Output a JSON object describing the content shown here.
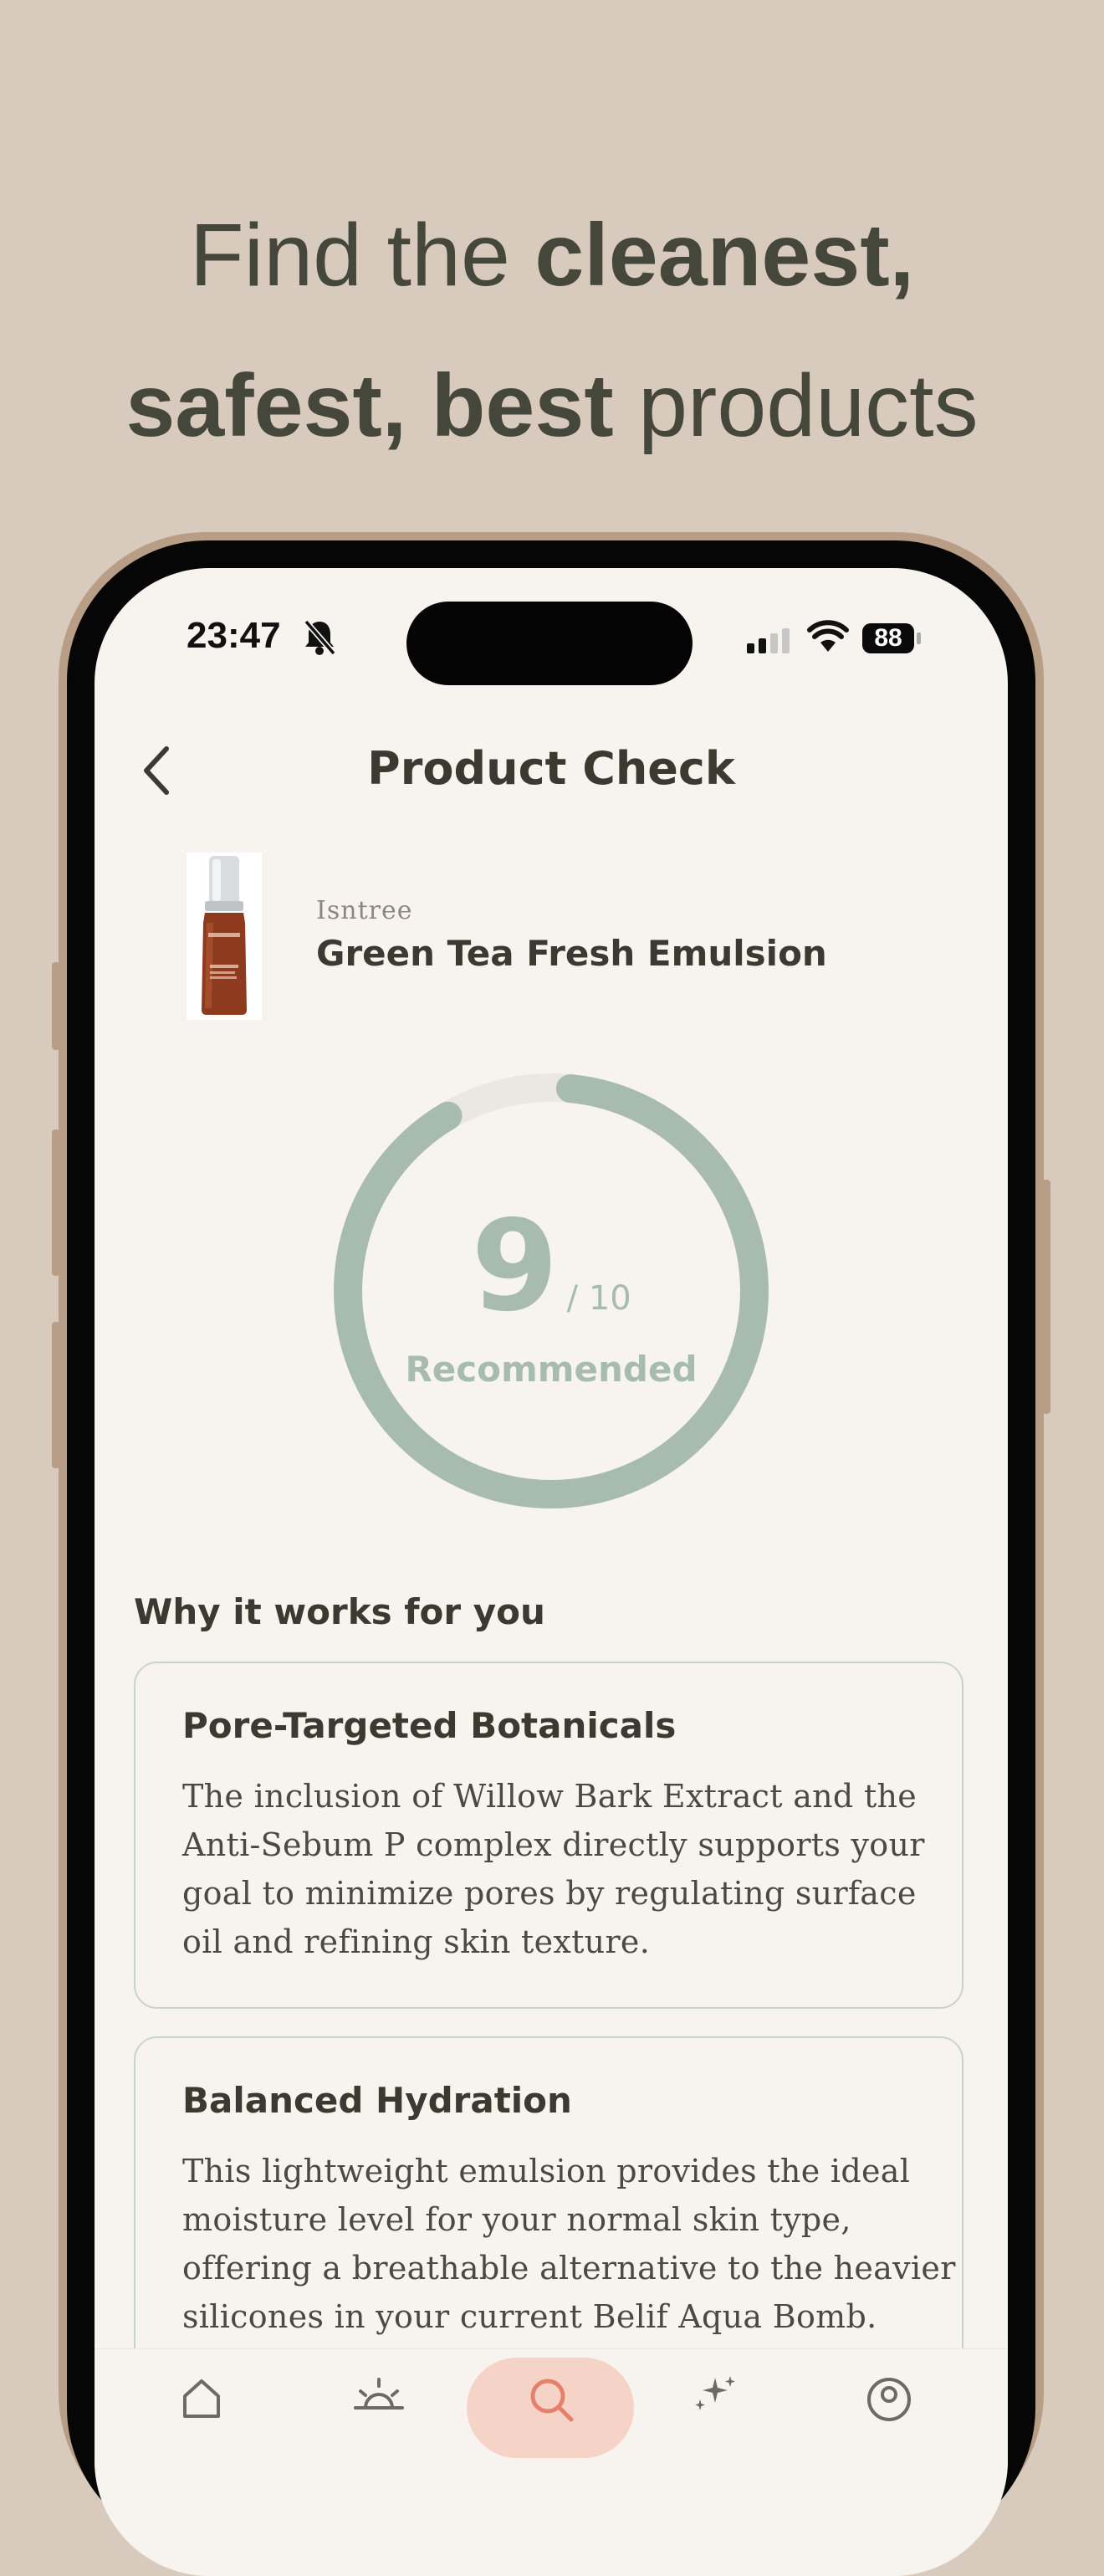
{
  "marketing": {
    "line1_regular": "Find the ",
    "line1_bold": "cleanest,",
    "line2_bold": "safest, best",
    "line2_regular": " products"
  },
  "status_bar": {
    "time": "23:47",
    "battery": "88"
  },
  "header": {
    "title": "Product Check"
  },
  "product": {
    "brand": "Isntree",
    "name": "Green Tea Fresh Emulsion"
  },
  "score": {
    "value": "9",
    "out_of": "/ 10",
    "label": "Recommended",
    "fraction": 0.9,
    "ring_color": "#a7bcae",
    "track_color": "#ebe8e2"
  },
  "section": {
    "title": "Why it works for you"
  },
  "cards": [
    {
      "title": "Pore-Targeted Botanicals",
      "lines": [
        "The inclusion of Willow Bark Extract and the",
        "Anti-Sebum P complex directly supports your",
        "goal to minimize pores by regulating surface",
        "oil and refining skin texture."
      ]
    },
    {
      "title": "Balanced Hydration",
      "lines": [
        "This lightweight emulsion provides the ideal",
        "moisture level for your normal skin type,",
        "offering a breathable alternative to the heavier",
        "silicones in your current Belif Aqua Bomb."
      ]
    }
  ],
  "tab_bar": {
    "items": [
      "home-icon",
      "sun-icon",
      "search-icon",
      "sparkles-icon",
      "profile-icon"
    ],
    "active_index": 2,
    "active_color": "#f6d3c7"
  },
  "colors": {
    "background": "#d9cabe",
    "screen": "#f7f3ef",
    "text": "#3b3a30",
    "accent_green": "#a7bcae"
  }
}
